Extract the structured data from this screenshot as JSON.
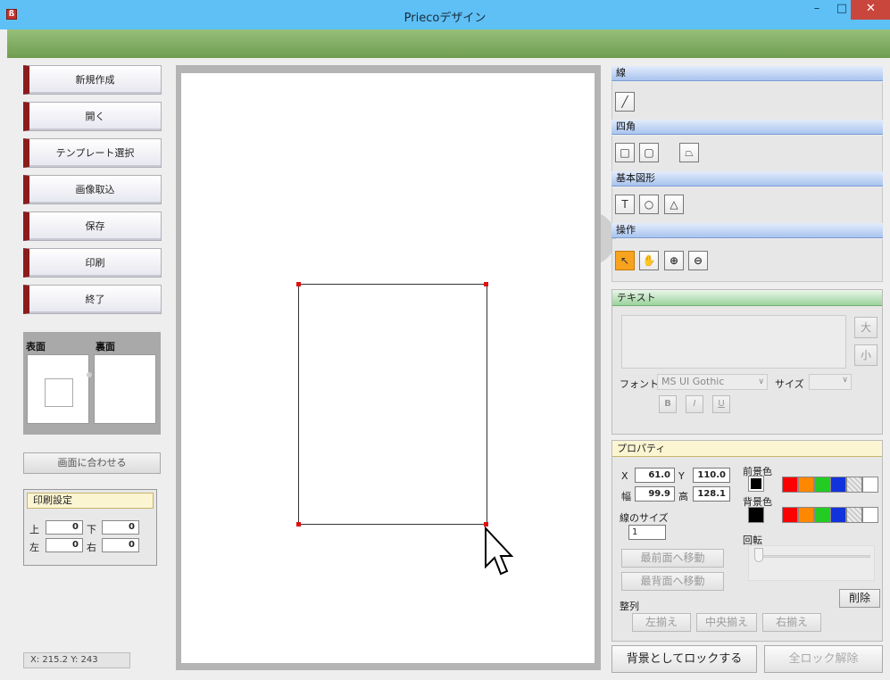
{
  "window": {
    "title": "Priecoデザイン",
    "app_icon": "ß",
    "min": "–",
    "max": "□",
    "close": "✕"
  },
  "menu": [
    "新規作成",
    "開く",
    "テンプレート選択",
    "画像取込",
    "保存",
    "印刷",
    "終了"
  ],
  "faces": {
    "front": "表面",
    "back": "裏面"
  },
  "fit_button": "画面に合わせる",
  "print_settings": {
    "title": "印刷設定",
    "top_label": "上",
    "top_value": "0",
    "bottom_label": "下",
    "bottom_value": "0",
    "left_label": "左",
    "left_value": "0",
    "right_label": "右",
    "right_value": "0"
  },
  "status": {
    "coords": "X: 215.2  Y: 243"
  },
  "tools": {
    "line_header": "線",
    "rect_header": "四角",
    "basic_header": "基本図形",
    "op_header": "操作",
    "line_icon": "╱",
    "rect_icon": "□",
    "round_icon": "▢",
    "trap_icon": "⏢",
    "text_icon": "T",
    "circle_icon": "○",
    "tri_icon": "△",
    "pointer_icon": "↖",
    "hand_icon": "✋",
    "zoomin_icon": "⊕",
    "zoomout_icon": "⊖"
  },
  "text_panel": {
    "title": "テキスト",
    "big": "大",
    "small": "小",
    "font_label": "フォント",
    "font_value": "MS UI Gothic",
    "size_label": "サイズ",
    "size_value": "",
    "bold": "B",
    "italic": "I",
    "underline": "U"
  },
  "props": {
    "title": "プロパティ",
    "x_label": "X",
    "x_value": "61.0",
    "y_label": "Y",
    "y_value": "110.0",
    "w_label": "幅",
    "w_value": "99.9",
    "h_label": "高",
    "h_value": "128.1",
    "fg_label": "前景色",
    "bg_label": "背景色",
    "line_size_label": "線のサイズ",
    "line_size_value": "1",
    "rotate_label": "回転",
    "front_btn": "最前面へ移動",
    "back_btn": "最背面へ移動",
    "delete_btn": "削除",
    "align_label": "整列",
    "align_left": "左揃え",
    "align_center": "中央揃え",
    "align_right": "右揃え"
  },
  "colors": {
    "fg": "#000000",
    "bg": "#000000",
    "palette": [
      "#ff0000",
      "#ff8800",
      "#22cc22",
      "#1133dd",
      "#cccccc",
      "#ffffff"
    ]
  },
  "bottom": {
    "lock": "背景としてロックする",
    "unlock": "全ロック解除"
  }
}
